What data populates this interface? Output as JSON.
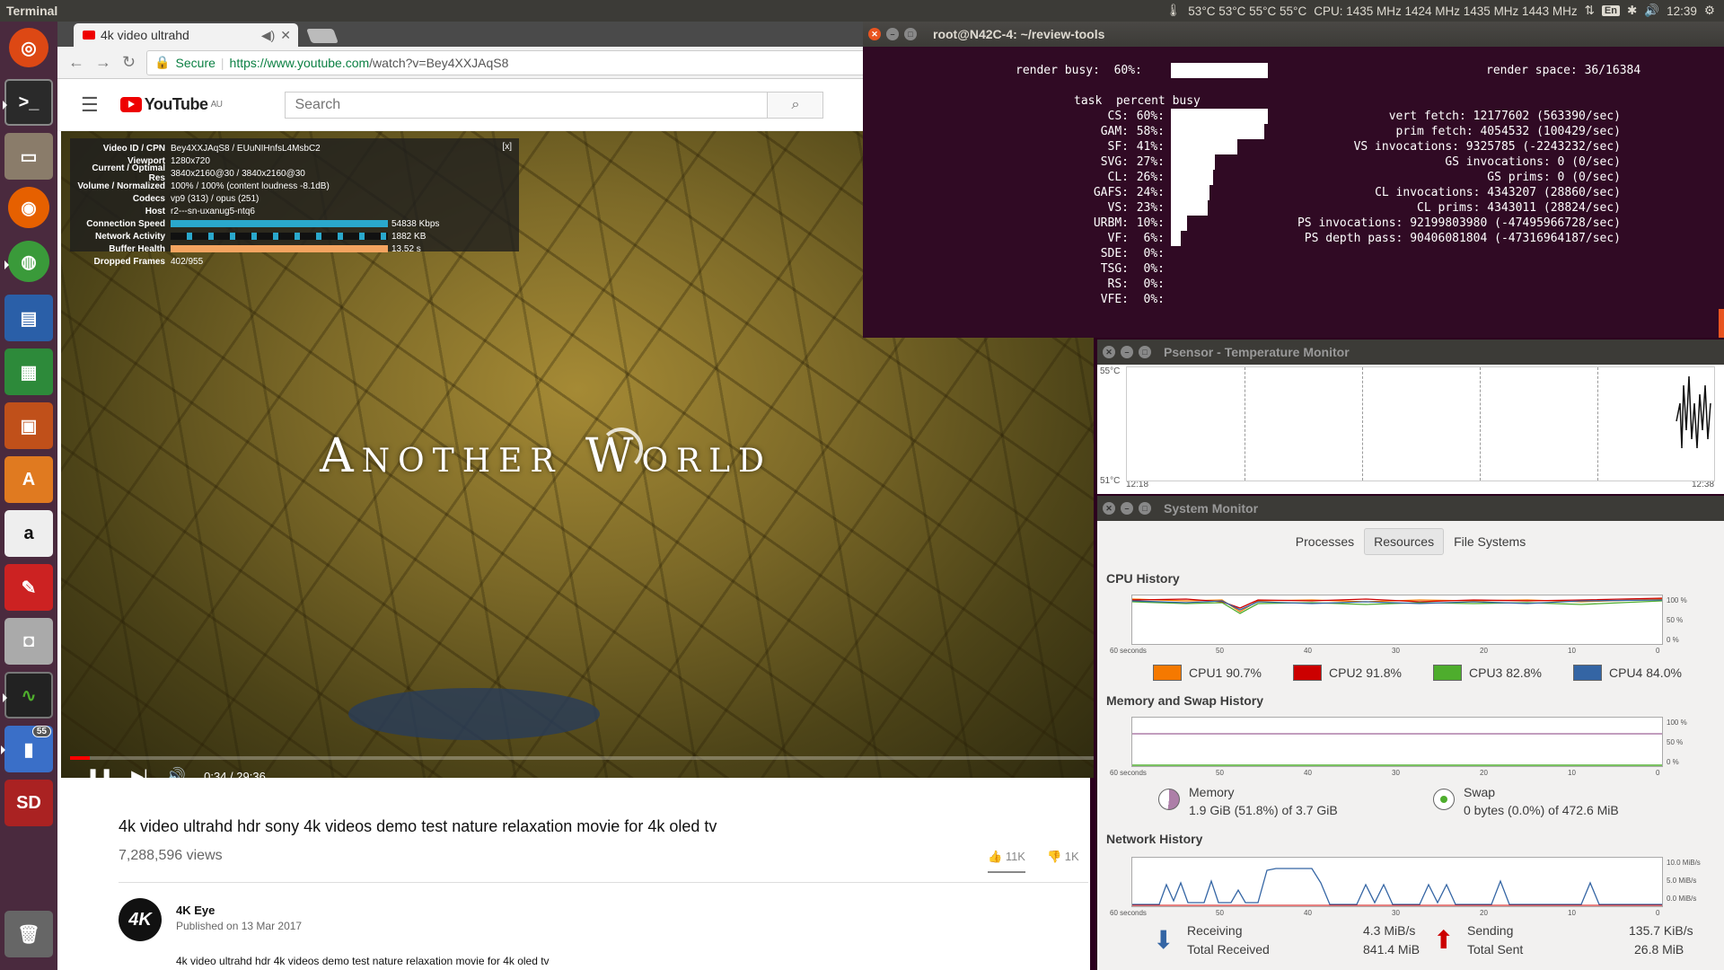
{
  "topbar": {
    "app_title": "Terminal",
    "temps": "53°C 53°C 55°C 55°C",
    "cpu": "CPU: 1435 MHz 1424 MHz 1435 MHz 1443 MHz",
    "keyboard": "En",
    "time": "12:39"
  },
  "browser": {
    "tab_title": "4k video ultrahd",
    "secure_label": "Secure",
    "url_host": "https://www.youtube.com",
    "url_path": "/watch?v=Bey4XXJAqS8"
  },
  "youtube": {
    "logo_text": "YouTube",
    "region": "AU",
    "search_placeholder": "Search",
    "video_overlay_title": "Another World",
    "stats": [
      {
        "label": "Video ID / CPN",
        "value": "Bey4XXJAqS8 / EUuNIHnfsL4MsbC2"
      },
      {
        "label": "Viewport",
        "value": "1280x720"
      },
      {
        "label": "Current / Optimal Res",
        "value": "3840x2160@30 / 3840x2160@30"
      },
      {
        "label": "Volume / Normalized",
        "value": "100% / 100% (content loudness -8.1dB)"
      },
      {
        "label": "Codecs",
        "value": "vp9 (313) / opus (251)"
      },
      {
        "label": "Host",
        "value": "r2---sn-uxanug5-ntq6"
      },
      {
        "label": "Connection Speed",
        "value": "54838 Kbps"
      },
      {
        "label": "Network Activity",
        "value": "1882 KB"
      },
      {
        "label": "Buffer Health",
        "value": "13.52 s"
      },
      {
        "label": "Dropped Frames",
        "value": "402/955"
      }
    ],
    "stats_close": "[x]",
    "time": "0:34 / 29:36",
    "progress": 0.019,
    "title": "4k video ultrahd hdr sony 4k videos demo test nature relaxation movie for 4k oled tv",
    "views": "7,288,596 views",
    "likes": "11K",
    "dislikes": "1K",
    "channel_avatar": "4K",
    "channel": "4K Eye",
    "published": "Published on 13 Mar 2017",
    "description": "4k video ultrahd hdr 4k videos demo test nature relaxation movie for 4k oled tv"
  },
  "terminal": {
    "title": "root@N42C-4: ~/review-tools",
    "render_busy": "render busy:  60%:",
    "render_busy_pct": 60,
    "render_space": "render space: 36/16384",
    "header": "task  percent busy",
    "tasks": [
      {
        "name": "CS:",
        "pct": 60
      },
      {
        "name": "GAM:",
        "pct": 58
      },
      {
        "name": "SF:",
        "pct": 41
      },
      {
        "name": "SVG:",
        "pct": 27
      },
      {
        "name": "CL:",
        "pct": 26
      },
      {
        "name": "GAFS:",
        "pct": 24
      },
      {
        "name": "VS:",
        "pct": 23
      },
      {
        "name": "URBM:",
        "pct": 10
      },
      {
        "name": "VF:",
        "pct": 6
      },
      {
        "name": "SDE:",
        "pct": 0
      },
      {
        "name": "TSG:",
        "pct": 0
      },
      {
        "name": "RS:",
        "pct": 0
      },
      {
        "name": "VFE:",
        "pct": 0
      }
    ],
    "counters": [
      "vert fetch: 12177602 (563390/sec)",
      "prim fetch: 4054532 (100429/sec)",
      "VS invocations: 9325785 (-2243232/sec)",
      "GS invocations: 0 (0/sec)",
      "GS prims: 0 (0/sec)",
      "CL invocations: 4343207 (28860/sec)",
      "CL prims: 4343011 (28824/sec)",
      "PS invocations: 92199803980 (-47495966728/sec)",
      "PS depth pass: 90406081804 (-47316964187/sec)"
    ]
  },
  "psensor": {
    "title": "Psensor - Temperature Monitor",
    "y_max": "55°C",
    "y_min": "51°C",
    "x_start": "12:18",
    "x_end": "12:38"
  },
  "sysmon": {
    "title": "System Monitor",
    "tabs": [
      "Processes",
      "Resources",
      "File Systems"
    ],
    "cpu_title": "CPU History",
    "cpus": [
      {
        "label": "CPU1",
        "value": "90.7%",
        "color": "#f57900"
      },
      {
        "label": "CPU2",
        "value": "91.8%",
        "color": "#cc0000"
      },
      {
        "label": "CPU3",
        "value": "82.8%",
        "color": "#4ead2d"
      },
      {
        "label": "CPU4",
        "value": "84.0%",
        "color": "#3465a4"
      }
    ],
    "mem_title": "Memory and Swap History",
    "memory_label": "Memory",
    "memory_value": "1.9 GiB (51.8%) of 3.7 GiB",
    "swap_label": "Swap",
    "swap_value": "0 bytes (0.0%) of 472.6 MiB",
    "net_title": "Network History",
    "receiving_label": "Receiving",
    "receiving_value": "4.3 MiB/s",
    "total_received_label": "Total Received",
    "total_received_value": "841.4 MiB",
    "sending_label": "Sending",
    "sending_value": "135.7 KiB/s",
    "total_sent_label": "Total Sent",
    "total_sent_value": "26.8 MiB",
    "x_ticks": [
      "60 seconds",
      "50",
      "40",
      "30",
      "20",
      "10",
      "0"
    ],
    "pct_ticks": [
      "100 %",
      "50 %",
      "0 %"
    ],
    "net_ticks": [
      "10.0 MiB/s",
      "5.0 MiB/s",
      "0.0 MiB/s"
    ]
  }
}
